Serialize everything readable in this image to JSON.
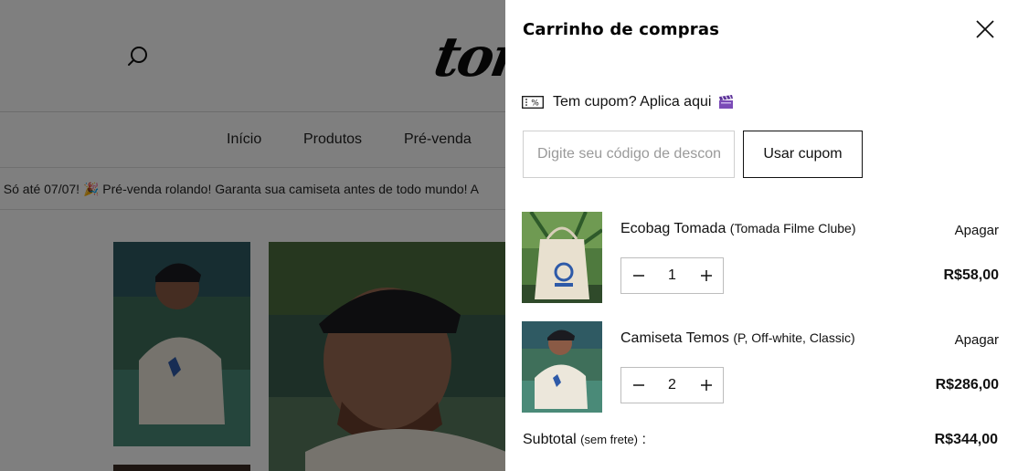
{
  "background": {
    "logo_text": "tom",
    "nav": [
      "Início",
      "Produtos",
      "Pré-venda"
    ],
    "marquee_text": ". Só até 07/07! 🎉 Pré-venda rolando! Garanta sua camiseta antes de todo mundo! A"
  },
  "cart": {
    "title": "Carrinho de compras",
    "coupon": {
      "toggle_label": "Tem cupom? Aplica aqui",
      "input_placeholder": "Digite seu código de desconto",
      "input_value": "",
      "button_label": "Usar cupom"
    },
    "items": [
      {
        "name": "Ecobag Tomada",
        "variant": "(Tomada Filme Clube)",
        "remove_label": "Apagar",
        "quantity": "1",
        "price": "R$58,00"
      },
      {
        "name": "Camiseta Temos",
        "variant": "(P, Off-white, Classic)",
        "remove_label": "Apagar",
        "quantity": "2",
        "price": "R$286,00"
      }
    ],
    "subtotal": {
      "label": "Subtotal",
      "note": "(sem frete)",
      "colon": " :",
      "value": "R$344,00"
    }
  },
  "icons": {
    "search": "search-icon",
    "close": "close-icon",
    "coupon": "percent-ticket-icon",
    "clapper": "clapperboard-icon",
    "minus": "minus-icon",
    "plus": "plus-icon"
  },
  "colors": {
    "overlay": "#000000",
    "text": "#111111",
    "border": "#cfcfcf"
  }
}
